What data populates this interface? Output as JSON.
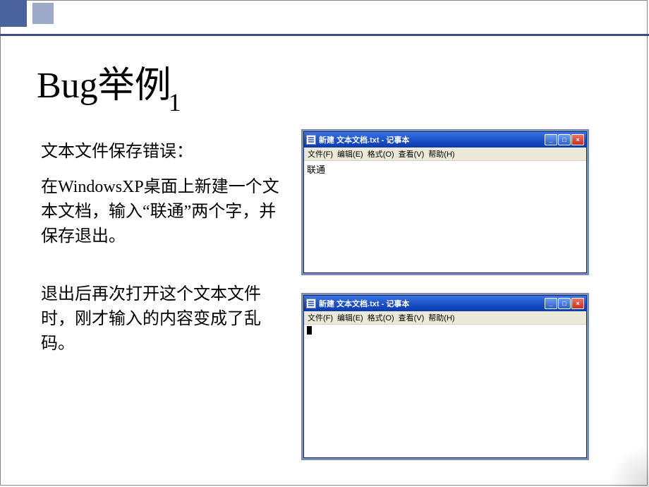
{
  "deco": {},
  "title": {
    "main": "Bug举例",
    "sub": "1"
  },
  "body": {
    "heading": "文本文件保存错误：",
    "p1": "在WindowsXP桌面上新建一个文本文档，输入“联通”两个字，并保存退出。",
    "p2": "退出后再次打开这个文本文件时，刚才输入的内容变成了乱码。"
  },
  "notepad1": {
    "title": "新建 文本文档.txt - 记事本",
    "menu": {
      "file": "文件(F)",
      "edit": "编辑(E)",
      "format": "格式(O)",
      "view": "查看(V)",
      "help": "帮助(H)"
    },
    "content": "联通"
  },
  "notepad2": {
    "title": "新建 文本文档.txt - 记事本",
    "menu": {
      "file": "文件(F)",
      "edit": "编辑(E)",
      "format": "格式(O)",
      "view": "查看(V)",
      "help": "帮助(H)"
    },
    "content_garbled": true
  },
  "winbtns": {
    "min": "_",
    "max": "□",
    "close": "×"
  }
}
